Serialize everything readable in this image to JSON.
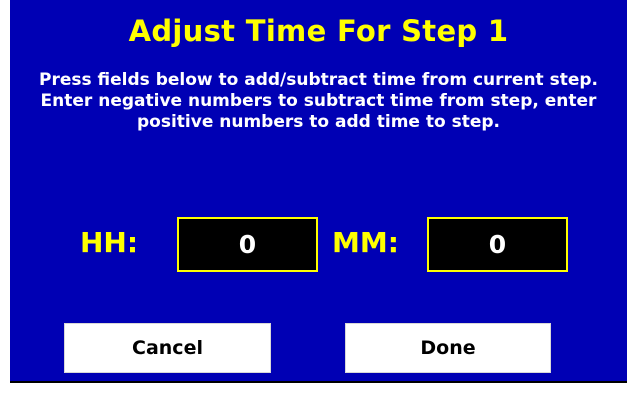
{
  "colors": {
    "background": "#0000b4",
    "title_text": "#ffff00",
    "body_text": "#ffffff",
    "field_background": "#000000",
    "field_border": "#ffff00",
    "button_background": "#ffffff"
  },
  "title": "Adjust Time For Step 1",
  "instructions": "Press fields below to add/subtract time from current step.  Enter negative numbers to subtract time from step, enter positive numbers to add time to step.",
  "fields": {
    "hours": {
      "label": "HH:",
      "value": "0"
    },
    "minutes": {
      "label": "MM:",
      "value": "0"
    }
  },
  "buttons": {
    "cancel": "Cancel",
    "done": "Done"
  }
}
